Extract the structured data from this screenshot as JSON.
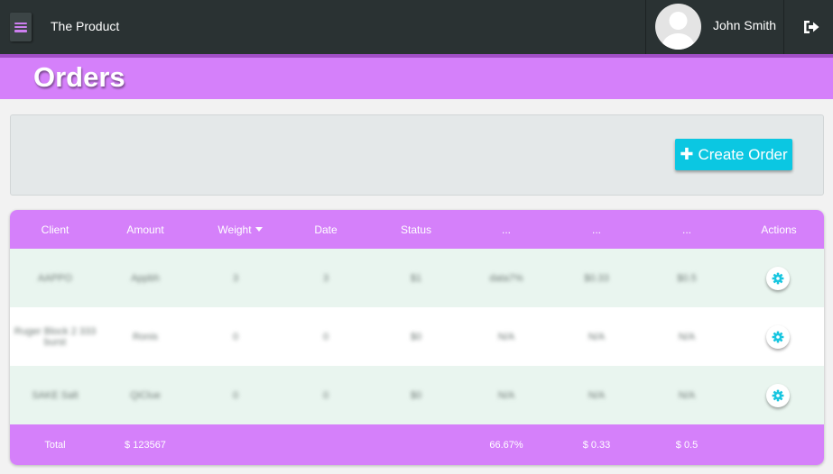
{
  "app": {
    "title": "The Product"
  },
  "user": {
    "name": "John Smith"
  },
  "page": {
    "title": "Orders"
  },
  "toolbar": {
    "create_label": "Create Order"
  },
  "table": {
    "columns": [
      "Client",
      "Amount",
      "Weight",
      "Date",
      "Status",
      "...",
      "...",
      "...",
      "Actions"
    ],
    "sorted_column": "Weight",
    "rows": [
      [
        "AAPPO",
        "Appbh",
        "3",
        "3",
        "$1",
        "data7%",
        "$0.33",
        "$0.5"
      ],
      [
        "Ruger Block 2 333 burst",
        "Ronis",
        "0",
        "0",
        "$0",
        "N/A",
        "N/A",
        "N/A"
      ],
      [
        "SAKE Salt",
        "QiClue",
        "0",
        "0",
        "$0",
        "N/A",
        "N/A",
        "N/A"
      ]
    ],
    "footer": [
      "Total",
      "$ 123567",
      "",
      "",
      "",
      "66.67%",
      "$ 0.33",
      "$ 0.5",
      ""
    ]
  },
  "colors": {
    "topbar": "#2a3233",
    "accent_purple": "#d580fa",
    "button_cyan": "#0bc7e2",
    "row_alt": "#e9f5ef"
  },
  "icons": {
    "menu": "hamburger-icon",
    "logout": "sign-out-icon",
    "avatar": "user-silhouette",
    "create": "plus-icon",
    "row_action": "gear-icon"
  }
}
